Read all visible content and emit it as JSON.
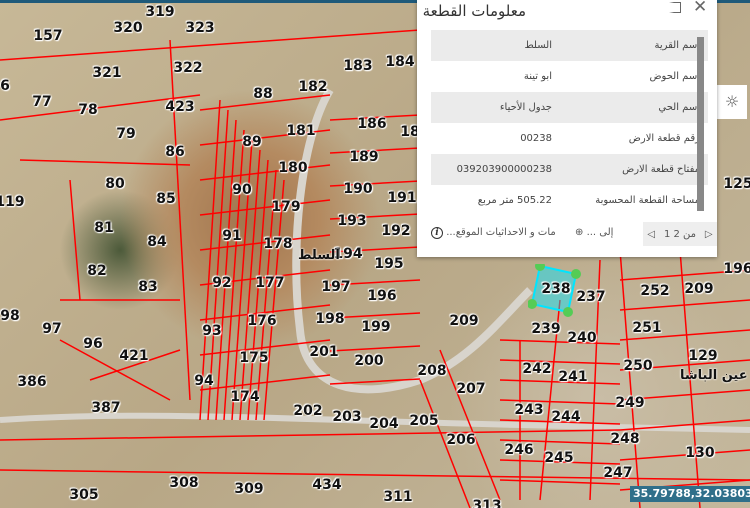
{
  "popup": {
    "title": "معلومات القطعة",
    "rows": [
      {
        "label": "اسم القرية",
        "value": "السلط"
      },
      {
        "label": "اسم الحوض",
        "value": "ابو تينة"
      },
      {
        "label": "اسم الحي",
        "value": "جدول الأحياء"
      },
      {
        "label": "رقم قطعة الارض",
        "value": "00238"
      },
      {
        "label": "مفتاح قطعة الارض",
        "value": "039203900000238"
      },
      {
        "label": "مساحة القطعة المحسوبة",
        "value": "505.22 متر مربع"
      }
    ],
    "pager": "1 من 2",
    "zoom_to": "... إلى",
    "info_text": "...مات و الاحداثيات الموقع"
  },
  "map": {
    "town_labels": [
      "السلط",
      "عين الباشا"
    ],
    "selected_parcel": "238",
    "selected_color": "#00e5ff",
    "parcels": [
      "319",
      "323",
      "320",
      "157",
      "321",
      "322",
      "77",
      "78",
      "6",
      "423",
      "88",
      "182",
      "183",
      "184",
      "79",
      "86",
      "89",
      "181",
      "186",
      "18",
      "189",
      "180",
      "80",
      "85",
      "90",
      "179",
      "190",
      "191",
      "119",
      "81",
      "84",
      "91",
      "178",
      "193",
      "192",
      "82",
      "83",
      "92",
      "177",
      "194",
      "195",
      "197",
      "196",
      "98",
      "97",
      "96",
      "93",
      "176",
      "198",
      "199",
      "209",
      "239",
      "240",
      "251",
      "252",
      "209",
      "196",
      "125",
      "421",
      "175",
      "201",
      "200",
      "208",
      "207",
      "242",
      "241",
      "250",
      "129",
      "386",
      "94",
      "174",
      "202",
      "203",
      "204",
      "205",
      "243",
      "244",
      "249",
      "387",
      "206",
      "246",
      "245",
      "248",
      "130",
      "247",
      "308",
      "309",
      "434",
      "311",
      "313",
      "305",
      "237"
    ],
    "parcel_line_color": "#ff0000"
  },
  "coords": "35.79788,32.03803"
}
